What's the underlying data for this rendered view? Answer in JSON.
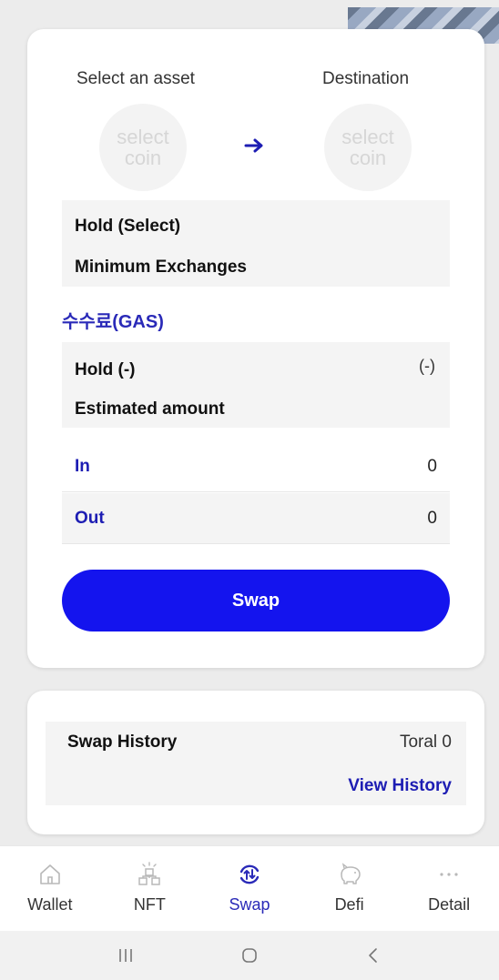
{
  "swap": {
    "from_label": "Select an asset",
    "to_label": "Destination",
    "from_coin_placeholder": "select coin",
    "to_coin_placeholder": "select coin",
    "hold_select": "Hold (Select)",
    "minimum_exchanges": "Minimum Exchanges",
    "gas_label": "수수료(GAS)",
    "hold_dash": "Hold (-)",
    "hold_dash_value": "(-)",
    "estimated_amount": "Estimated amount",
    "in_label": "In",
    "in_value": "0",
    "out_label": "Out",
    "out_value": "0",
    "swap_button": "Swap"
  },
  "history": {
    "title": "Swap History",
    "total": "Toral 0",
    "view_link": "View History"
  },
  "nav": {
    "items": [
      {
        "label": "Wallet",
        "icon": "home-icon"
      },
      {
        "label": "NFT",
        "icon": "nft-icon"
      },
      {
        "label": "Swap",
        "icon": "swap-icon",
        "active": true
      },
      {
        "label": "Defi",
        "icon": "piggy-bank-icon"
      },
      {
        "label": "Detail",
        "icon": "more-icon"
      }
    ]
  },
  "colors": {
    "accent": "#1414ee",
    "accent_text": "#1d1db3"
  }
}
